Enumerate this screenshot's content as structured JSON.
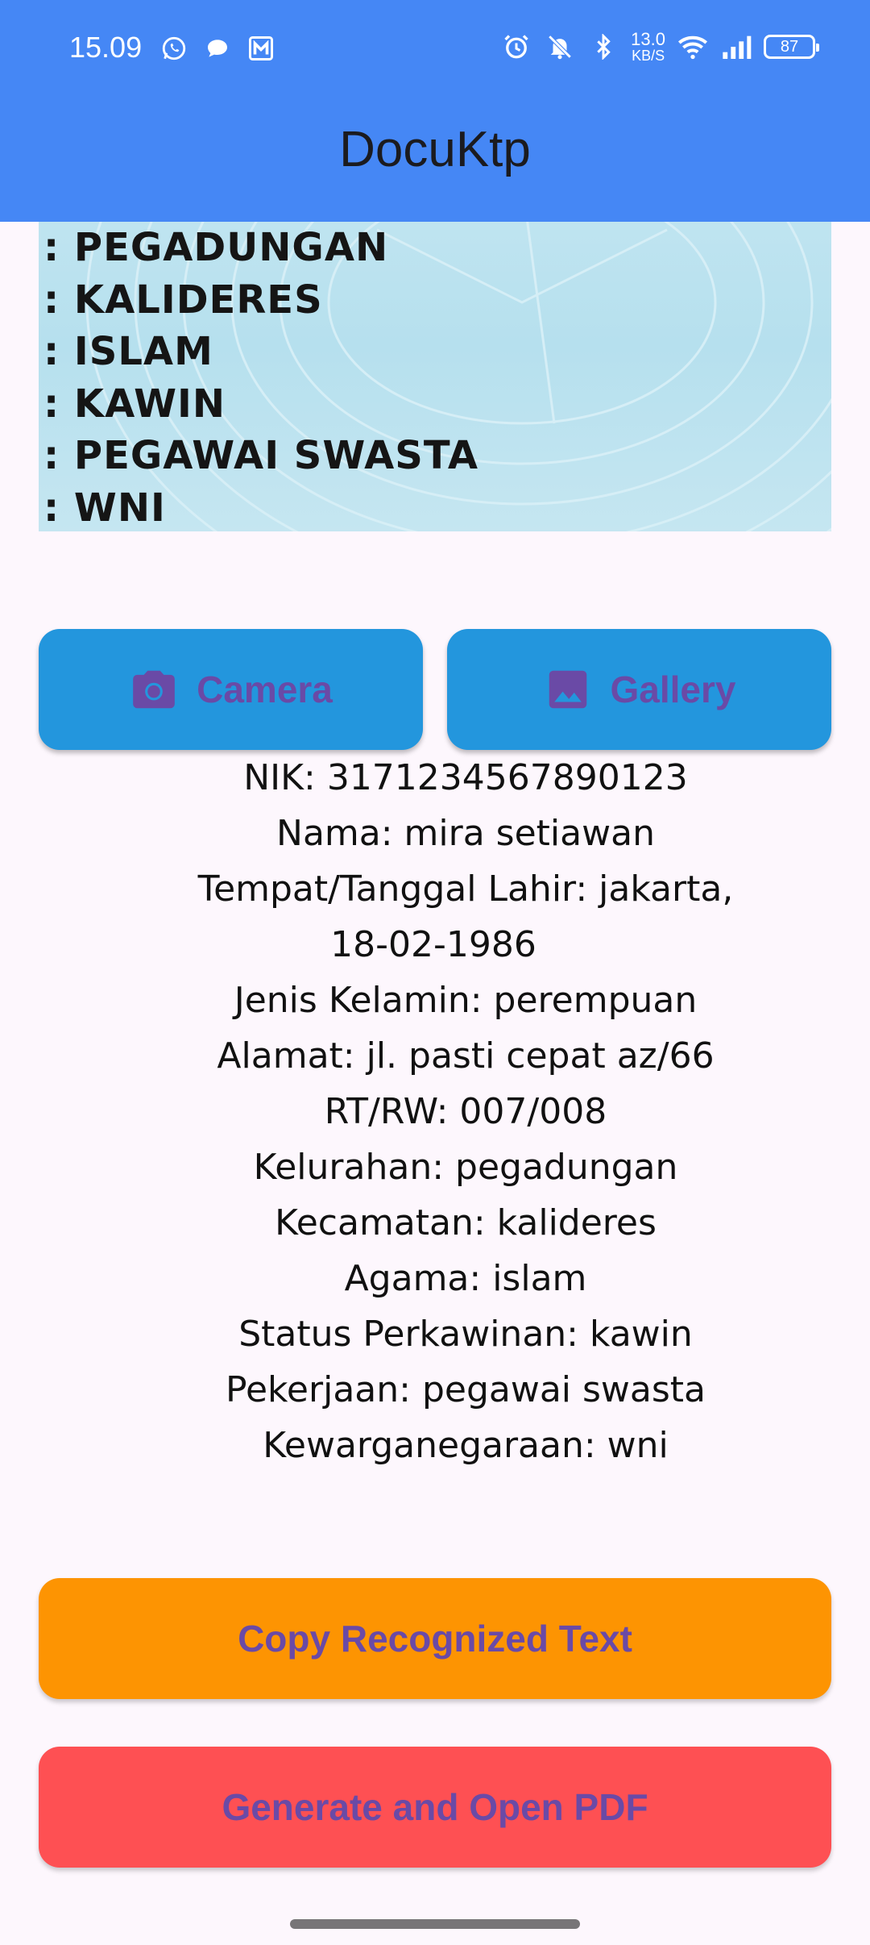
{
  "status_bar": {
    "time": "15.09",
    "network_speed_value": "13.0",
    "network_speed_unit": "KB/S",
    "battery_level": "87",
    "left_icons": [
      "whatsapp-icon",
      "chat-icon",
      "m-app-icon"
    ],
    "right_icons": [
      "alarm-icon",
      "mute-icon",
      "bluetooth-icon",
      "wifi-icon",
      "signal-icon",
      "battery-icon"
    ]
  },
  "app_bar": {
    "title": "DocuKtp"
  },
  "ktp_image": {
    "lines": [
      ": PEGADUNGAN",
      ": KALIDERES",
      ": ISLAM",
      ": KAWIN",
      ": PEGAWAI SWASTA",
      ": WNI"
    ]
  },
  "buttons": {
    "camera_label": "Camera",
    "gallery_label": "Gallery",
    "copy_label": "Copy Recognized Text",
    "pdf_label": "Generate and Open PDF"
  },
  "recognized_text": {
    "nik": "NIK: 3171234567890123",
    "nama": "Nama: mira setiawan",
    "ttl_line1": "Tempat/Tanggal Lahir: jakarta,",
    "ttl_line2": "18-02-1986",
    "jenis_kelamin": "Jenis Kelamin: perempuan",
    "alamat": "Alamat: jl. pasti cepat az/66",
    "rt_rw": "RT/RW: 007/008",
    "kelurahan": "Kelurahan: pegadungan",
    "kecamatan": "Kecamatan: kalideres",
    "agama": "Agama: islam",
    "status_perkawinan": "Status Perkawinan: kawin",
    "pekerjaan": "Pekerjaan: pegawai swasta",
    "kewarganegaraan": "Kewarganegaraan: wni"
  },
  "colors": {
    "app_bar": "#4587f5",
    "photo_buttons": "#2396dd",
    "copy_button": "#fd9402",
    "pdf_button": "#fe5053",
    "button_text": "#6a4aa6",
    "background": "#fdf7fd"
  }
}
